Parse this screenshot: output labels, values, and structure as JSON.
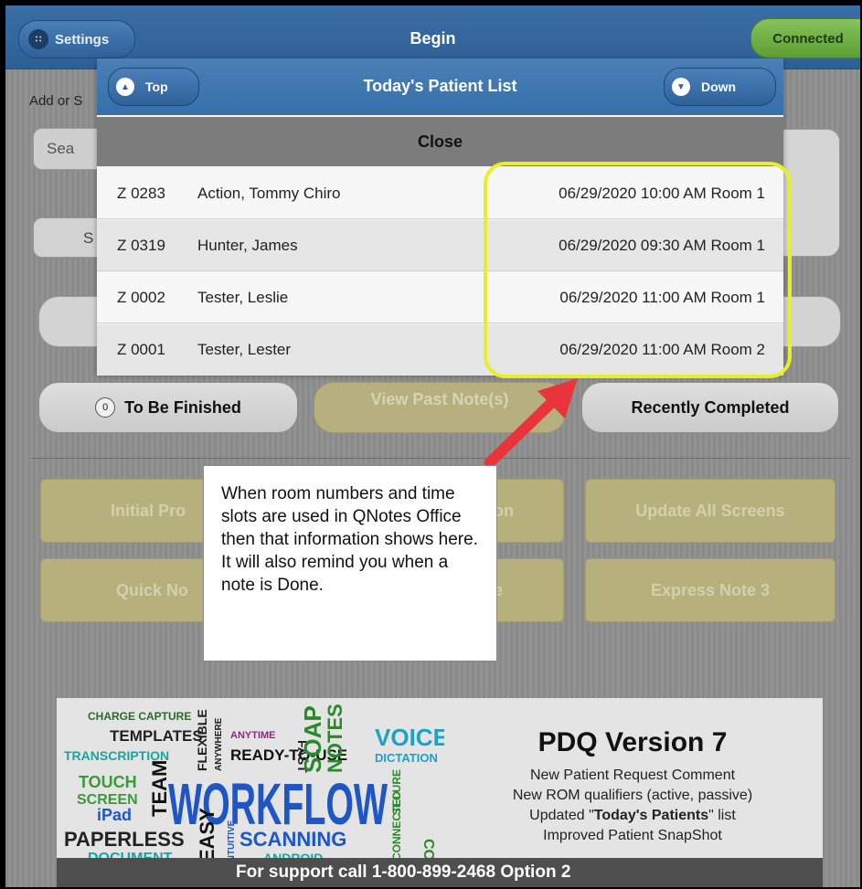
{
  "header": {
    "settings_label": "Settings",
    "title": "Begin",
    "status_label": "Connected"
  },
  "form": {
    "add_label": "Add or S",
    "search_text": "Sea",
    "select_text": "S"
  },
  "buttons": {
    "to_be_finished": "To Be Finished",
    "to_be_finished_count": "0",
    "view_past_notes": "View Past Note(s)",
    "recently_completed": "Recently Completed"
  },
  "tiles": {
    "initial_prog": "Initial Pro",
    "middle_top_suffix": "on",
    "update_all": "Update All Screens",
    "quick_note": "Quick No",
    "middle_bottom_suffix": "e",
    "express_note": "Express Note 3"
  },
  "modal": {
    "top_label": "Top",
    "title": "Today's Patient List",
    "down_label": "Down",
    "close_label": "Close",
    "patients": [
      {
        "code": "Z 0283",
        "name": "Action, Tommy Chiro",
        "appointment": "06/29/2020 10:00 AM Room 1"
      },
      {
        "code": "Z 0319",
        "name": "Hunter, James",
        "appointment": "06/29/2020 09:30 AM Room 1"
      },
      {
        "code": "Z 0002",
        "name": "Tester, Leslie",
        "appointment": "06/29/2020 11:00 AM Room 1"
      },
      {
        "code": "Z 0001",
        "name": "Tester, Lester",
        "appointment": "06/29/2020 11:00 AM Room 2"
      }
    ]
  },
  "callout": {
    "text": "When room numbers and time slots are used in QNotes Office then that information shows here. It will also remind you when a note is Done."
  },
  "banner": {
    "title": "PDQ Version 7",
    "line1": "New Patient Request Comment",
    "line2": "New ROM qualifiers (active, passive)",
    "line3_pre": "Updated \"",
    "line3_bold": "Today's Patients",
    "line3_post": "\" list",
    "line4": "Improved Patient SnapShot",
    "support": "For support call 1-800-899-2468 Option 2",
    "words": {
      "charge_capture": "CHARGE CAPTURE",
      "templates": "TEMPLATES",
      "transcription": "TRANSCRIPTION",
      "flexible": "FLEXIBLE",
      "anywhere": "ANYWHERE",
      "anytime": "ANYTIME",
      "ready_to_use": "READY-TO-USE",
      "fast": "FAST",
      "soap": "SOAP",
      "notes": "NOTES",
      "voice": "VOICE",
      "dictation": "DICTATION",
      "touch": "TOUCH",
      "screen": "SCREEN",
      "team": "TEAM",
      "workflow": "WORKFLOW",
      "secure": "SECURE",
      "compliant": "COMPLIANT",
      "ipad": "iPad",
      "paperless": "PAPERLESS",
      "easy": "EASY",
      "intuitive": "INTUITIVE",
      "scanning": "SCANNING",
      "connected": "CONNECTED",
      "document": "DOCUMENT",
      "android": "ANDROID"
    }
  },
  "colors": {
    "header_blue": "#3570aa",
    "connected_green": "#6fae43",
    "highlight_yellow": "#e5f02a",
    "arrow_red": "#e8343a"
  }
}
